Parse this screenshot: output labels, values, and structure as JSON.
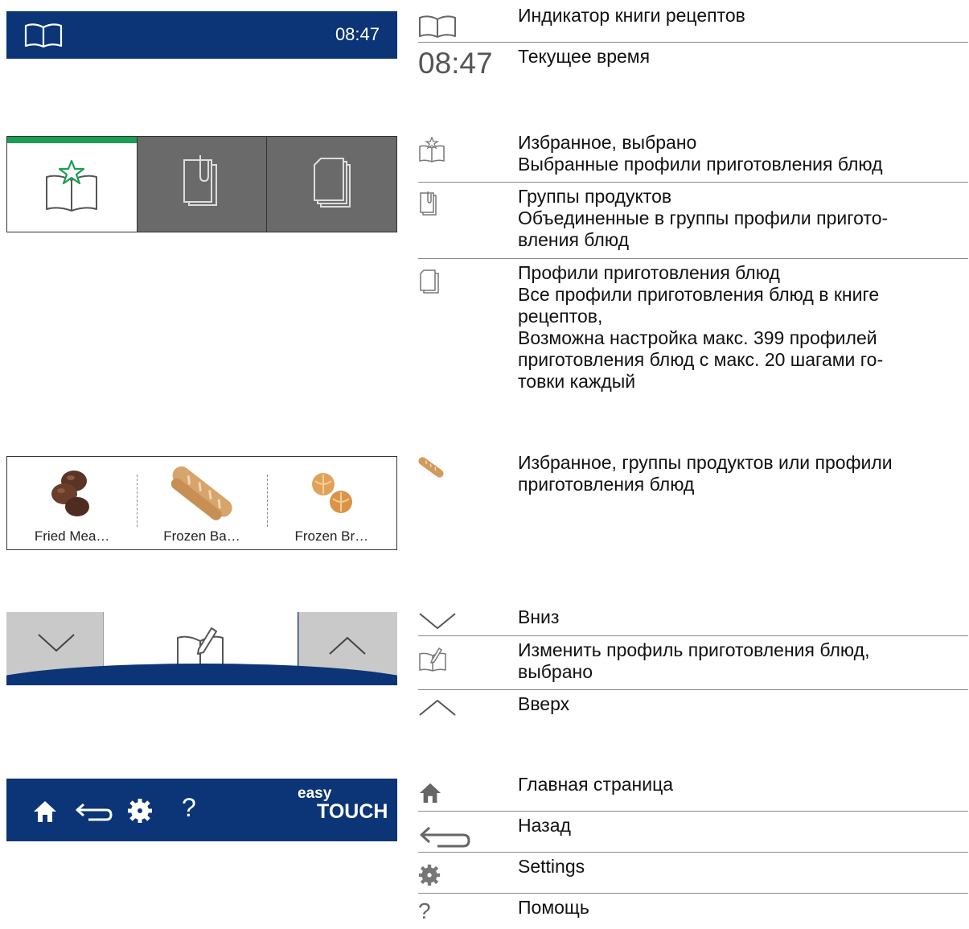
{
  "topbar": {
    "time": "08:47",
    "icon": "book-icon"
  },
  "tabs": [
    {
      "name": "favorites",
      "icon": "book-star-icon",
      "selected": true
    },
    {
      "name": "product-groups",
      "icon": "paperclip-pages-icon"
    },
    {
      "name": "cooking-profiles",
      "icon": "pages-stack-icon"
    }
  ],
  "foods": [
    {
      "label": "Fried Mea…",
      "icon": "meatballs-image"
    },
    {
      "label": "Frozen Ba…",
      "icon": "baguette-image"
    },
    {
      "label": "Frozen Br…",
      "icon": "bread-rolls-image"
    }
  ],
  "navbar": {
    "down_icon": "chevron-down-icon",
    "edit_icon": "book-pencil-icon",
    "up_icon": "chevron-up-icon"
  },
  "bottombar": {
    "icons": [
      "home-icon",
      "back-arrow-icon",
      "settings-gear-icon",
      "help-icon"
    ],
    "help_glyph": "?",
    "logo_top": "easy",
    "logo_bottom": "TOUCH"
  },
  "legend": {
    "g1": {
      "recipe_indicator": "Индикатор книги рецептов",
      "time_value": "08:47",
      "time_text": "Текущее время"
    },
    "g2": {
      "fav_title": "Избранное, выбрано",
      "fav_desc": "Выбранные профили приготовления блюд",
      "groups_title": "Группы продуктов",
      "groups_desc_1": "Объединенные в группы профили пригото-",
      "groups_desc_2": "вления блюд",
      "profiles_title": "Профили приготовления блюд",
      "profiles_desc_1": "Все профили приготовления блюд в книге",
      "profiles_desc_2": "рецептов,",
      "profiles_desc_3": "Возможна настройка макс. 399 профилей",
      "profiles_desc_4": "приготовления блюд с макс. 20 шагами го-",
      "profiles_desc_5": "товки каждый"
    },
    "g3": {
      "text_1": "Избранное, группы продуктов или профили",
      "text_2": "приготовления блюд"
    },
    "g4": {
      "down": "Вниз",
      "edit_1": "Изменить профиль приготовления блюд,",
      "edit_2": "выбрано",
      "up": "Вверх"
    },
    "g5": {
      "home": "Главная страница",
      "back": "Назад",
      "settings": "Settings",
      "help": "Помощь",
      "help_glyph": "?"
    }
  },
  "colors": {
    "brand_blue": "#0b3576",
    "selected_green": "#19a052",
    "tab_gray": "#6a6a6a"
  }
}
